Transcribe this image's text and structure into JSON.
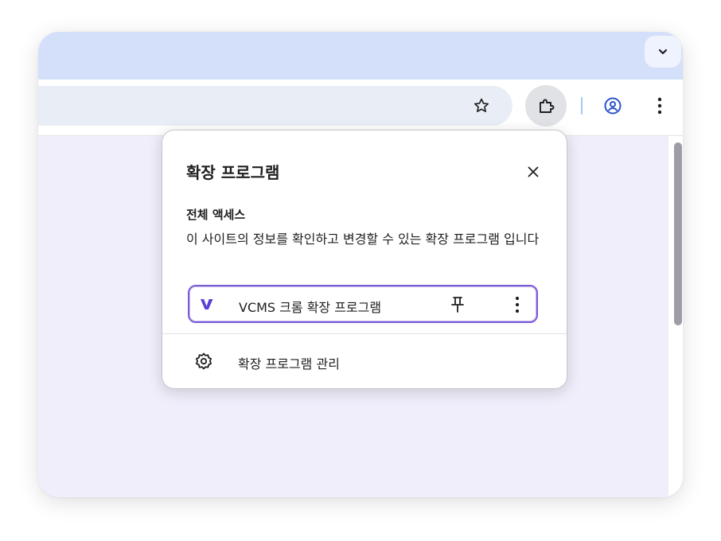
{
  "toolbar": {
    "bookmark_icon": "star-outline-icon",
    "extensions_icon": "puzzle-piece-icon",
    "profile_icon": "account-circle-icon",
    "menu_icon": "three-dot-vertical-icon",
    "tab_search_icon": "chevron-down-icon"
  },
  "popup": {
    "title": "확장 프로그램",
    "close_icon": "close-icon",
    "section_heading": "전체 액세스",
    "section_description": "이 사이트의 정보를 확인하고 변경할 수 있는 확장 프로그램 입니다",
    "extensions": [
      {
        "name": "VCMS 크롬 확장 프로그램",
        "logo": "vcms-v-logo",
        "pin_icon": "pin-icon",
        "more_icon": "three-dot-vertical-icon"
      }
    ],
    "manage_label": "확장 프로그램 관리",
    "manage_icon": "gear-icon"
  },
  "colors": {
    "tabstrip": "#d4e0fa",
    "page_background": "#f0eefb",
    "accent": "#5b3ed6",
    "focus_ring": "#7b5cd6"
  }
}
